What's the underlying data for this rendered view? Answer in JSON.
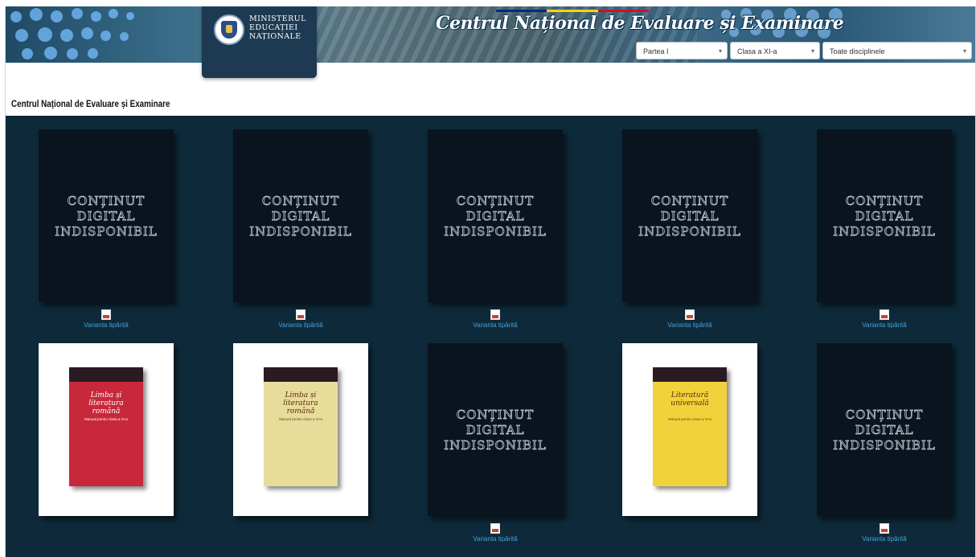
{
  "header": {
    "site_title": "Centrul Național de Evaluare și Examinare",
    "ministry_lines": [
      "MINISTERUL",
      "EDUCAȚIEI",
      "NAȚIONALE"
    ],
    "tricolor": [
      "#002b7f",
      "#fcd116",
      "#ce1126"
    ],
    "filters": {
      "part": "Partea I",
      "grade": "Clasa a XI-a",
      "discipline": "Toate disciplinele"
    }
  },
  "page": {
    "title": "Centrul Național de Evaluare și Examinare"
  },
  "grid": {
    "unavailable_text": [
      "Conținut",
      "digital",
      "indisponibil"
    ],
    "print_label": "Varianta tipărită",
    "rows": [
      [
        {
          "kind": "unavailable",
          "print": true
        },
        {
          "kind": "unavailable",
          "print": true
        },
        {
          "kind": "unavailable",
          "print": true
        },
        {
          "kind": "unavailable",
          "print": true
        },
        {
          "kind": "unavailable",
          "print": true
        }
      ],
      [
        {
          "kind": "book",
          "print": false,
          "cover_title": "Limba și literatura română",
          "cover_sub": "Manual pentru clasa a XI-a",
          "cover_color": "#c8283c"
        },
        {
          "kind": "book",
          "print": false,
          "cover_title": "Limba și literatura română",
          "cover_sub": "Manual pentru clasa a XI-a",
          "cover_color": "#e8dc9a"
        },
        {
          "kind": "unavailable",
          "print": true
        },
        {
          "kind": "book",
          "print": false,
          "cover_title": "Literatură universală",
          "cover_sub": "Manual pentru clasa a XI-a",
          "cover_color": "#f2d23a"
        },
        {
          "kind": "unavailable",
          "print": true
        }
      ]
    ]
  }
}
